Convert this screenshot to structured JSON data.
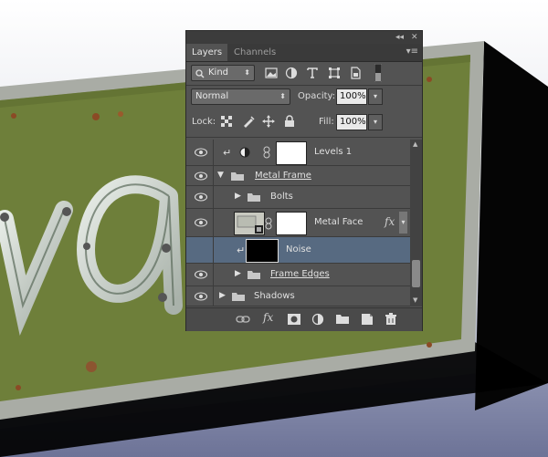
{
  "panel": {
    "tabs": [
      {
        "label": "Layers",
        "active": true
      },
      {
        "label": "Channels",
        "active": false
      }
    ],
    "collapse_glyph": "◂◂",
    "close_glyph": "✕",
    "menu_glyph": "▾≡",
    "filter": {
      "label": "Kind",
      "icon": "search-icon"
    },
    "filter_icons": [
      "image-filter-icon",
      "adjustment-filter-icon",
      "type-filter-icon",
      "shape-filter-icon",
      "smart-object-filter-icon",
      "filter-toggle-icon"
    ],
    "blend_mode": "Normal",
    "opacity": {
      "label": "Opacity:",
      "value": "100%"
    },
    "lock": {
      "label": "Lock:",
      "icons": [
        "lock-transparent-icon",
        "lock-image-icon",
        "lock-position-icon",
        "lock-all-icon"
      ]
    },
    "fill": {
      "label": "Fill:",
      "value": "100%"
    },
    "layers": [
      {
        "name": "Levels 1",
        "visible": true,
        "clipped": true,
        "type": "adjustment",
        "selected": false
      },
      {
        "name": "Metal Frame",
        "visible": true,
        "type": "group",
        "expanded": true,
        "selected": false
      },
      {
        "name": "Bolts",
        "visible": true,
        "type": "group",
        "expanded": false,
        "selected": false
      },
      {
        "name": "Metal Face",
        "visible": true,
        "type": "smart-object",
        "fx": "fx",
        "selected": false
      },
      {
        "name": "Noise",
        "visible": false,
        "clipped": true,
        "type": "pixel",
        "selected": true
      },
      {
        "name": "Frame Edges",
        "visible": true,
        "type": "group",
        "expanded": false,
        "selected": false
      },
      {
        "name": "Shadows",
        "visible": true,
        "type": "group",
        "expanded": false,
        "selected": false
      }
    ],
    "bottom_icons": [
      "link-icon",
      "fx-icon",
      "mask-icon",
      "adjustment-icon",
      "new-group-icon",
      "new-layer-icon",
      "trash-icon"
    ],
    "fx_label": "fx"
  }
}
